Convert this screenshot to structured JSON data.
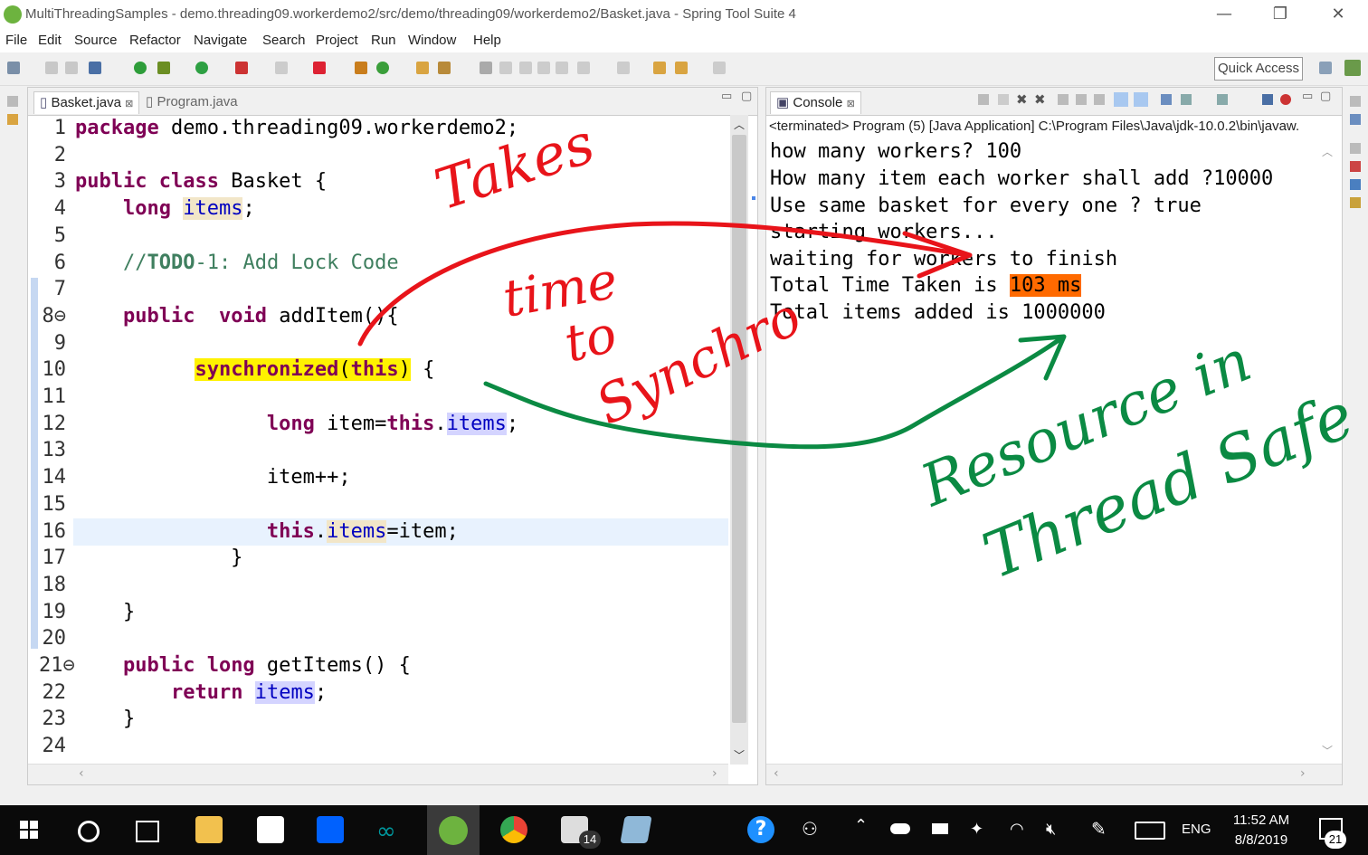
{
  "window": {
    "title": "MultiThreadingSamples - demo.threading09.workerdemo2/src/demo/threading09/workerdemo2/Basket.java - Spring Tool Suite 4",
    "min": "—",
    "max": "❐",
    "close": "✕"
  },
  "menu": [
    "File",
    "Edit",
    "Source",
    "Refactor",
    "Navigate",
    "Search",
    "Project",
    "Run",
    "Window",
    "Help"
  ],
  "toolbar": {
    "quick_access": "Quick Access"
  },
  "editor": {
    "tabs": [
      {
        "label": "Basket.java",
        "close": "⊠",
        "active": true
      },
      {
        "label": "Program.java",
        "active": false
      }
    ],
    "lines": [
      {
        "n": "1",
        "html": "<span class='kw'>package</span> demo.threading09.workerdemo2;"
      },
      {
        "n": "2",
        "html": ""
      },
      {
        "n": "3",
        "html": "<span class='kw'>public class</span> Basket {"
      },
      {
        "n": "4",
        "html": "    <span class='kw'>long</span> <span class='fld hl-occ' style='background:#f2e6c8'>items</span>;"
      },
      {
        "n": "5",
        "html": ""
      },
      {
        "n": "6",
        "html": "    <span class='cm'>//<b>TODO</b>-1: Add Lock Code</span>"
      },
      {
        "n": "7",
        "html": ""
      },
      {
        "n": "8⊖",
        "html": "    <span class='kw'>public</span>  <span class='kw'>void</span> addItem(){"
      },
      {
        "n": "9",
        "html": ""
      },
      {
        "n": "10",
        "html": "          <span class='hl-yellow'><span class='kw'>synchronized</span>(<span class='kw'>this</span>)</span> {"
      },
      {
        "n": "11",
        "html": ""
      },
      {
        "n": "12",
        "html": "                <span class='kw'>long</span> item=<span class='kw'>this</span>.<span class='fld hl-occ'>items</span>;"
      },
      {
        "n": "13",
        "html": ""
      },
      {
        "n": "14",
        "html": "                item++;"
      },
      {
        "n": "15",
        "html": ""
      },
      {
        "n": "16",
        "html": "                <span class='kw'>this</span>.<span class='fld hl-occ' style='background:#f2e6c8'>items</span>=item;"
      },
      {
        "n": "17",
        "html": "             }"
      },
      {
        "n": "18",
        "html": ""
      },
      {
        "n": "19",
        "html": "    }"
      },
      {
        "n": "20",
        "html": ""
      },
      {
        "n": "21⊖",
        "html": "    <span class='kw'>public long</span> getItems() {"
      },
      {
        "n": "22",
        "html": "        <span class='kw'>return</span> <span class='fld hl-occ'>items</span>;"
      },
      {
        "n": "23",
        "html": "    }"
      },
      {
        "n": "24",
        "html": ""
      }
    ]
  },
  "console": {
    "tab_label": "Console",
    "tab_close": "⊠",
    "status": "<terminated> Program (5) [Java Application] C:\\Program Files\\Java\\jdk-10.0.2\\bin\\javaw.",
    "lines": [
      "how many workers? 100",
      "How many item each worker shall add ?10000",
      "Use same basket for every one ? true",
      "starting workers...",
      "waiting for workers to finish",
      "Total Time Taken is ",
      "Total items added is 1000000"
    ],
    "time_value": "103 ms"
  },
  "annotations": {
    "red_1": "Takes",
    "red_2": "time",
    "red_3": "to",
    "red_4": "Synchro",
    "green_1": "Resource in",
    "green_2": "Thread Safe"
  },
  "taskbar": {
    "lang": "ENG",
    "time": "11:52 AM",
    "date": "8/8/2019",
    "mail_badge": "14",
    "notif_badge": "21"
  },
  "colors": {
    "keyword": "#7f0055",
    "comment": "#3f7f5f",
    "field": "#0000c0",
    "ink_red": "#e8141a",
    "ink_green": "#0b8a43",
    "highlight": "#fff200",
    "time_highlight": "#ff6a00"
  }
}
